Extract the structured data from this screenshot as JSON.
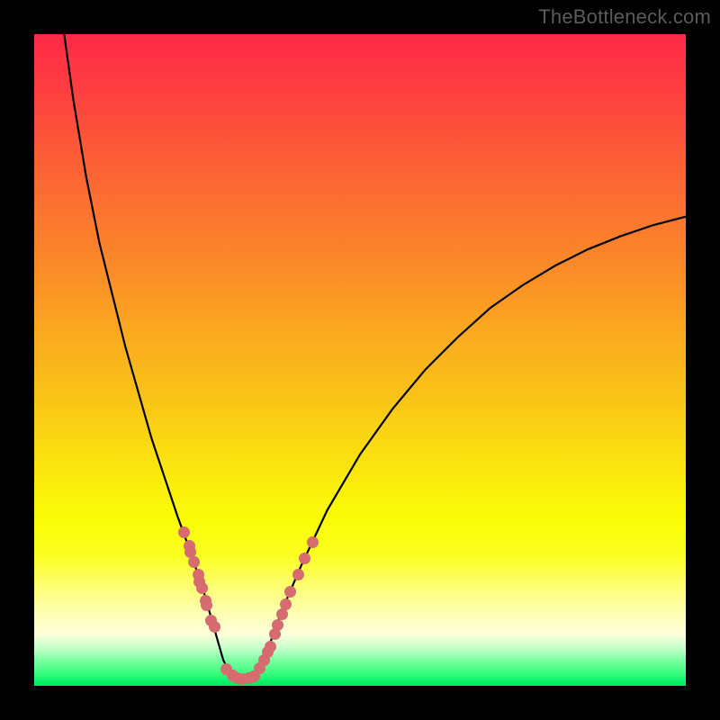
{
  "watermark": "TheBottleneck.com",
  "colors": {
    "frame": "#000000",
    "curve_stroke": "#000000",
    "dot_fill": "#d66c6f"
  },
  "chart_data": {
    "type": "line",
    "title": "",
    "xlabel": "",
    "ylabel": "",
    "xrange": [
      0,
      100
    ],
    "yrange": [
      0,
      100
    ],
    "series": [
      {
        "name": "bottleneck-curve",
        "x": [
          4.6,
          6.0,
          8.0,
          10.0,
          12.0,
          14.0,
          16.0,
          18.0,
          20.0,
          22.0,
          24.0,
          26.0,
          27.0,
          28.0,
          29.0,
          30.0,
          31.5,
          33.0,
          34.0,
          35.0,
          36.0,
          38.0,
          41.0,
          45.0,
          50.0,
          55.0,
          60.0,
          65.0,
          70.0,
          75.0,
          80.0,
          85.0,
          90.0,
          95.0,
          100.0
        ],
        "y": [
          100.0,
          90.0,
          78.0,
          68.0,
          60.0,
          52.0,
          45.0,
          38.0,
          32.0,
          26.0,
          20.5,
          14.5,
          11.0,
          7.5,
          4.0,
          2.0,
          1.0,
          1.0,
          1.7,
          3.5,
          6.0,
          11.5,
          18.5,
          27.0,
          35.5,
          42.5,
          48.5,
          53.5,
          58.0,
          61.5,
          64.5,
          67.0,
          69.0,
          70.7,
          72.0
        ]
      },
      {
        "name": "dots-left-cluster",
        "x": [
          23.0,
          23.8,
          24.0,
          24.5,
          25.2,
          25.4,
          25.8,
          26.3,
          26.5,
          27.2,
          27.7
        ],
        "y": [
          23.5,
          21.5,
          20.5,
          19.0,
          17.0,
          16.0,
          15.0,
          13.0,
          12.3,
          10.0,
          9.0
        ]
      },
      {
        "name": "dots-bottom-cluster",
        "x": [
          29.5,
          30.4,
          31.2,
          32.0,
          33.0,
          33.8
        ],
        "y": [
          2.5,
          1.6,
          1.2,
          1.1,
          1.2,
          1.5
        ]
      },
      {
        "name": "dots-right-cluster",
        "x": [
          34.6,
          35.3,
          35.8,
          36.2,
          37.0,
          37.4,
          38.0,
          38.6,
          39.3,
          40.5,
          41.5,
          42.7
        ],
        "y": [
          2.7,
          4.0,
          5.2,
          6.0,
          8.0,
          9.3,
          11.0,
          12.5,
          14.5,
          17.0,
          19.5,
          22.0
        ]
      }
    ]
  }
}
